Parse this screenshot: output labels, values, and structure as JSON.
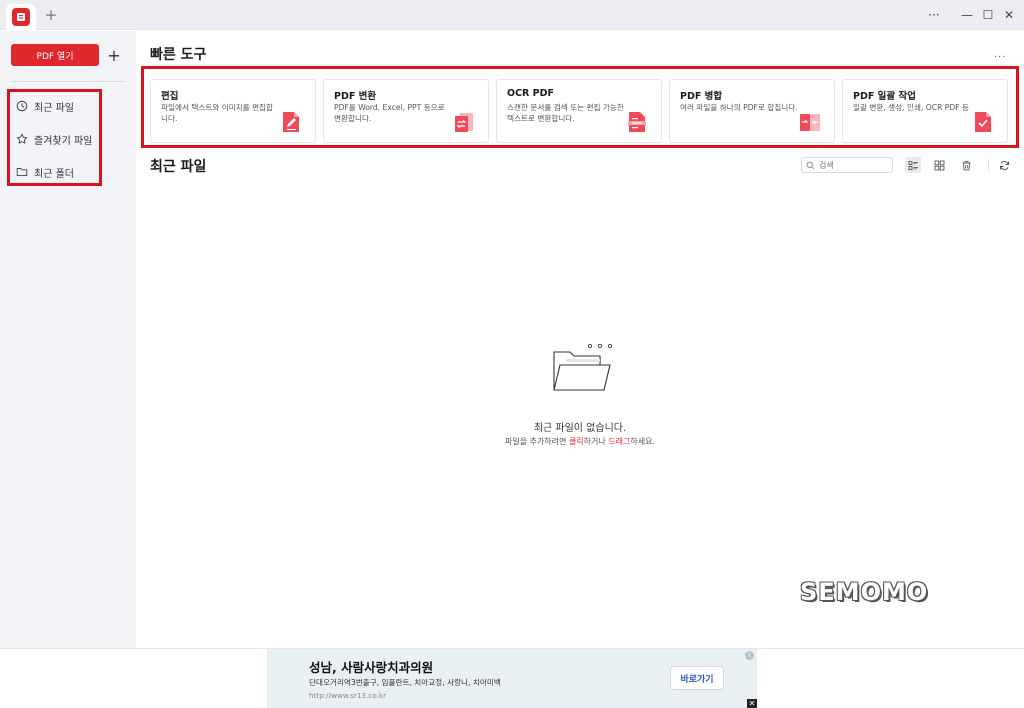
{
  "titlebar": {
    "new_tab": "+",
    "more": "···",
    "minimize": "—",
    "maximize": "☐",
    "close": "✕"
  },
  "sidebar": {
    "open_pdf": "PDF 열기",
    "add": "+",
    "items": [
      {
        "label": "최근 파일",
        "icon": "clock-icon"
      },
      {
        "label": "즐겨찾기 파일",
        "icon": "star-icon"
      },
      {
        "label": "최근 폴더",
        "icon": "folder-icon"
      }
    ]
  },
  "quick_tools": {
    "title": "빠른 도구",
    "more": "...",
    "cards": [
      {
        "title": "편집",
        "desc": "파일에서 텍스트와 이미지를 편집합니다.",
        "icon": "edit-pdf-icon"
      },
      {
        "title": "PDF 변환",
        "desc": "PDF를 Word, Excel, PPT 등으로 변환합니다.",
        "icon": "convert-icon"
      },
      {
        "title": "OCR PDF",
        "desc": "스캔한 문서를 검색 또는 편집 가능한 텍스트로 변환합니다.",
        "icon": "ocr-icon"
      },
      {
        "title": "PDF 병합",
        "desc": "여러 파일을 하나의 PDF로 합칩니다.",
        "icon": "merge-icon"
      },
      {
        "title": "PDF 일괄 작업",
        "desc": "일괄 변환, 생성, 인쇄, OCR PDF 등",
        "icon": "batch-icon"
      }
    ]
  },
  "recent": {
    "title": "최근 파일",
    "search_placeholder": "검색",
    "empty_title": "최근 파일이 없습니다.",
    "empty_sub_1": "파일을 추가하려면 ",
    "empty_sub_link1": "클릭",
    "empty_sub_2": "하거나 ",
    "empty_sub_link2": "드래그",
    "empty_sub_3": "하세요."
  },
  "watermark": "SEMOMO",
  "ad": {
    "title": "성남, 사람사랑치과의원",
    "desc": "단대오거리역3번출구, 임플란트, 치아교정, 사랑니, 치아미백",
    "url": "http://www.sr13.co.kr",
    "button": "바로가기",
    "info": "i",
    "close": "✕"
  },
  "colors": {
    "accent": "#e0272c",
    "highlight": "#d9141c"
  }
}
